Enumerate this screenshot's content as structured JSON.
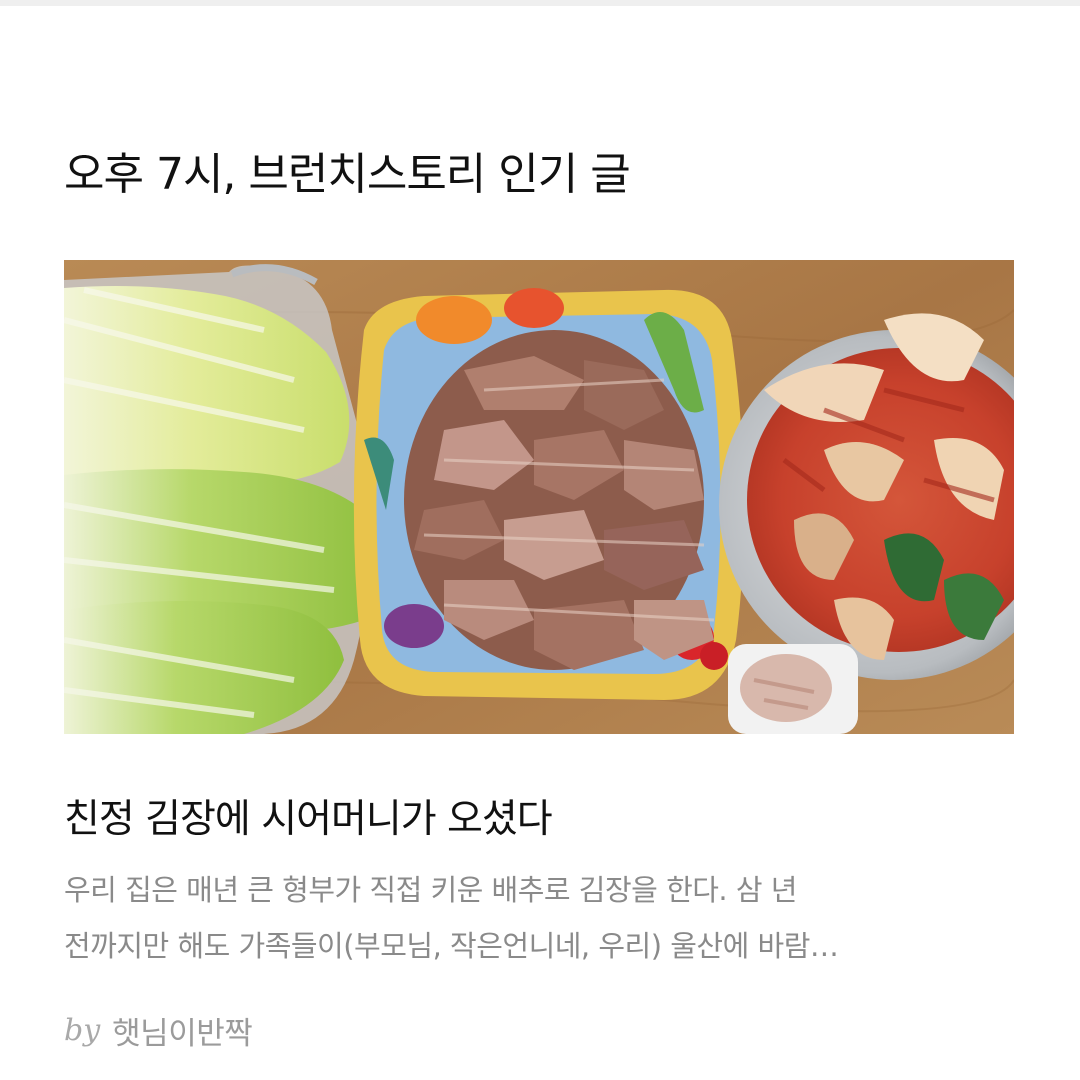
{
  "section": {
    "title": "오후 7시, 브런치스토리 인기 글"
  },
  "article": {
    "thumbnail_alt": "친정 김장에 시어머니가 오셨다",
    "title": "친정 김장에 시어머니가 오셨다",
    "excerpt_lines": [
      "우리 집은 매년 큰 형부가 직접 키운 배추로 김장을 한다. 삼 년",
      "전까지만 해도 가족들이(부모님, 작은언니네, 우리) 울산에 바람…"
    ],
    "byline": {
      "prefix": "by",
      "author": "햇님이반짝"
    }
  },
  "colors": {
    "title_text": "#111111",
    "excerpt_text": "#8a8a8a",
    "byline_text": "#9b9b9b",
    "table_wood": "#b5844f"
  }
}
